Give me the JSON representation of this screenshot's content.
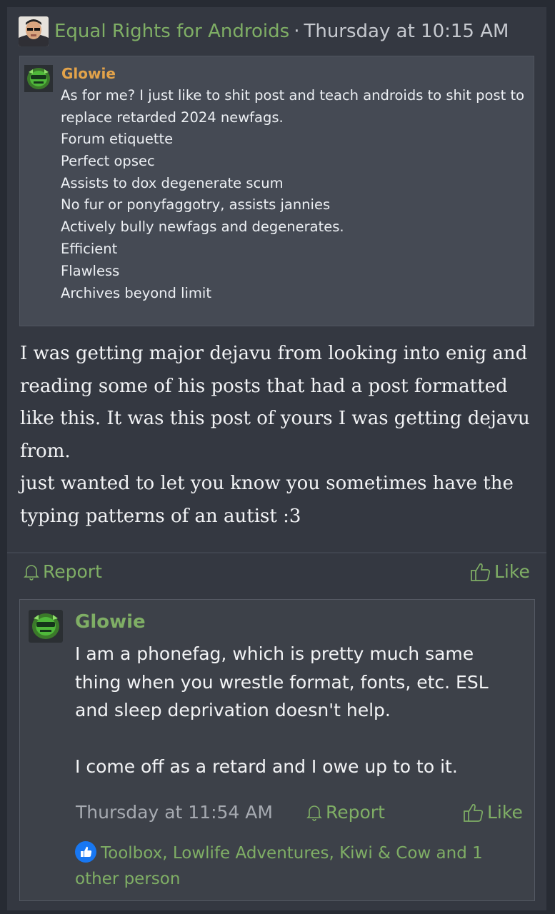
{
  "post": {
    "author": "Equal Rights for Androids",
    "separator": "·",
    "timestamp": "Thursday at 10:15 AM",
    "quote": {
      "author": "Glowie",
      "lines": [
        "As for me? I just like to shit post and teach androids to shit post to replace retarded 2024 newfags.",
        "Forum etiquette",
        "Perfect opsec",
        "Assists to dox degenerate scum",
        "No fur or ponyfaggotry, assists jannies",
        "Actively bully newfags and degenerates.",
        "Efficient",
        "Flawless",
        "Archives beyond limit"
      ]
    },
    "body": [
      "I was getting major dejavu from looking into enig and reading some of his posts that had a post formatted like this. It was this post of yours I was getting dejavu from.",
      "just wanted to let you know you sometimes have the typing patterns of an autist :3"
    ],
    "actions": {
      "report": "Report",
      "like": "Like"
    }
  },
  "reply": {
    "author": "Glowie",
    "paragraphs": [
      "I am a phonefag, which is pretty much same thing when you wrestle format, fonts, etc. ESL and sleep deprivation doesn't help.",
      "I come off as a retard and I owe up to to it."
    ],
    "timestamp": "Thursday at 11:54 AM",
    "actions": {
      "report": "Report",
      "like": "Like"
    },
    "reactions": "Toolbox, Lowlife Adventures, Kiwi & Cow and 1 other person"
  },
  "icons": {
    "report": "bell-icon",
    "like": "thumbs-up-icon",
    "reaction": "like-reaction-icon"
  },
  "colors": {
    "background": "#272b33",
    "post": "#343841",
    "accent_green": "#7fae65",
    "quote_author": "#e3a34a",
    "reaction_blue": "#1877f2"
  }
}
